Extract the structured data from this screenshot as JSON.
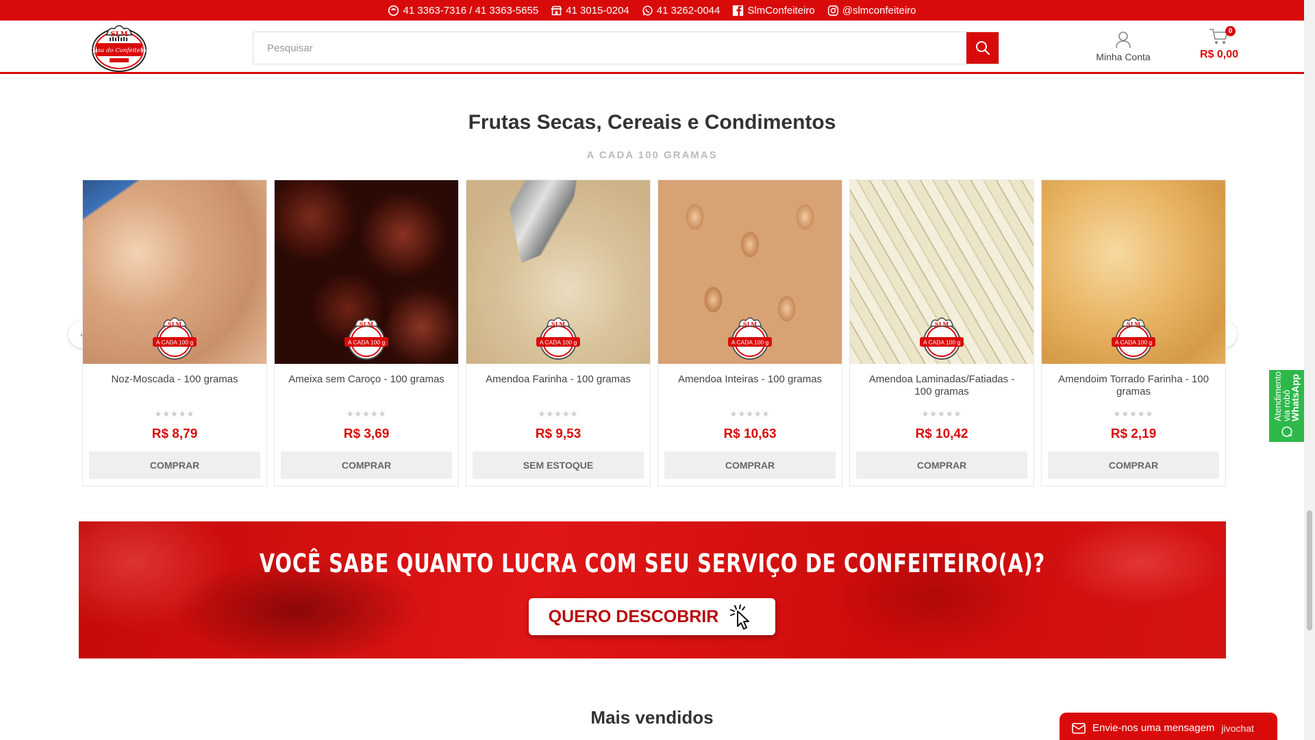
{
  "topbar": {
    "phone": "41 3363-7316 / 41 3363-5655",
    "store_phone": "41 3015-0204",
    "whatsapp": "41 3262-0044",
    "facebook": "SlmConfeiteiro",
    "instagram": "@slmconfeiteiro"
  },
  "logo": {
    "brand": "SLM",
    "tagline": "Casa do Confeiteiro"
  },
  "search": {
    "placeholder": "Pesquisar"
  },
  "account": {
    "label": "Minha Conta"
  },
  "cart": {
    "count": "0",
    "total": "R$ 0,00"
  },
  "section": {
    "title": "Frutas Secas, Cereais e Condimentos",
    "subtitle": "A CADA 100 GRAMAS"
  },
  "stamp_text": "A CADA 100 g",
  "products": [
    {
      "name": "Noz-Moscada - 100 gramas",
      "price": "R$ 8,79",
      "button": "COMPRAR"
    },
    {
      "name": "Ameixa sem Caroço - 100 gramas",
      "price": "R$ 3,69",
      "button": "COMPRAR"
    },
    {
      "name": "Amendoa Farinha - 100 gramas",
      "price": "R$ 9,53",
      "button": "SEM ESTOQUE"
    },
    {
      "name": "Amendoa Inteiras - 100 gramas",
      "price": "R$ 10,63",
      "button": "COMPRAR"
    },
    {
      "name": "Amendoa Laminadas/Fatiadas - 100 gramas",
      "price": "R$ 10,42",
      "button": "COMPRAR"
    },
    {
      "name": "Amendoim Torrado Farinha - 100 gramas",
      "price": "R$ 2,19",
      "button": "COMPRAR"
    }
  ],
  "banner": {
    "headline": "VOCÊ SABE QUANTO LUCRA COM SEU SERVIÇO DE CONFEITEIRO(A)?",
    "button": "QUERO DESCOBRIR"
  },
  "whatsapp_tab": {
    "line1": "Atendimento",
    "line2": "via robô",
    "line3": "WhatsApp"
  },
  "best_sellers": {
    "title": "Mais vendidos"
  },
  "chat": {
    "label": "Envie-nos uma mensagem",
    "brand": "jivochat"
  },
  "colors": {
    "brand_red": "#d90a0a",
    "star_gray": "#cccccc",
    "button_gray": "#efefef"
  }
}
